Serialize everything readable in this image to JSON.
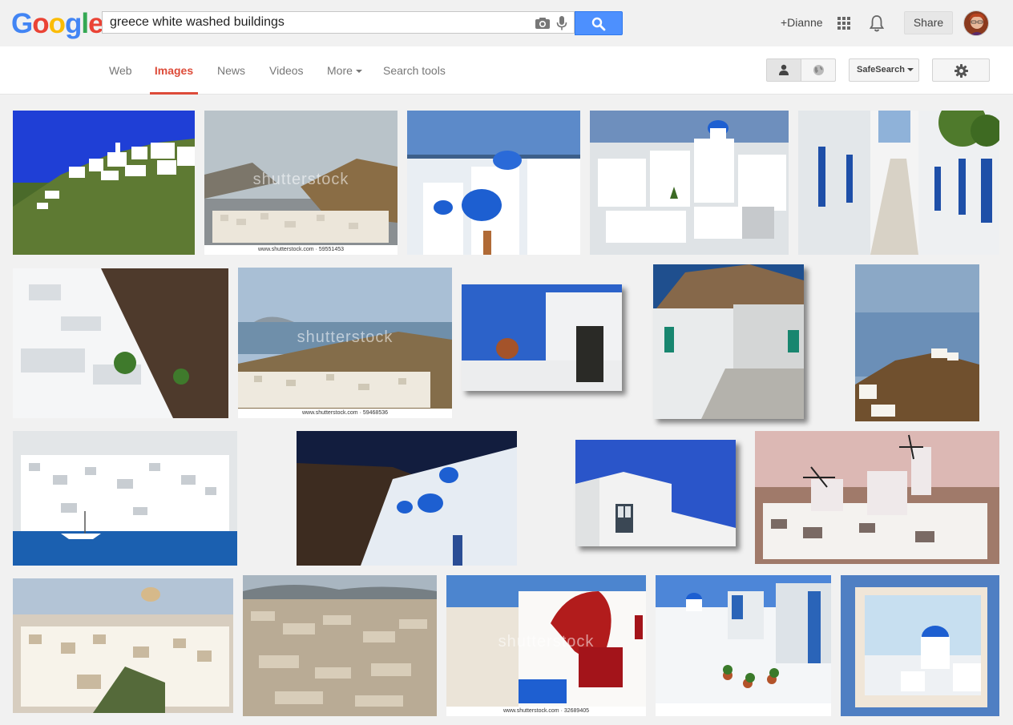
{
  "logo": {
    "letters": [
      "G",
      "o",
      "o",
      "g",
      "l",
      "e"
    ],
    "colors": [
      "#4285f4",
      "#ea4335",
      "#fbbc05",
      "#4285f4",
      "#34a853",
      "#ea4335"
    ]
  },
  "search": {
    "query": "greece white washed buildings"
  },
  "header": {
    "user_label": "+Dianne",
    "share_label": "Share"
  },
  "tabs": [
    {
      "label": "Web"
    },
    {
      "label": "Images",
      "active": true
    },
    {
      "label": "News"
    },
    {
      "label": "Videos"
    },
    {
      "label": "More"
    },
    {
      "label": "Search tools"
    }
  ],
  "tools": {
    "safesearch_label": "SafeSearch"
  },
  "watermarks": {
    "shutterstock": "shutterstock",
    "caption_1": "www.shutterstock.com · 59551453",
    "caption_2": "www.shutterstock.com · 59468536",
    "caption_3": "www.shutterstock.com · 32689405"
  },
  "colors": {
    "accent": "#dd4b39",
    "search_button": "#4d90fe",
    "greek_blue": "#1f5fc8"
  },
  "icons": [
    "camera-icon",
    "microphone-icon",
    "search-icon",
    "apps-grid-icon",
    "notifications-bell-icon",
    "person-icon",
    "globe-icon",
    "gear-icon"
  ]
}
